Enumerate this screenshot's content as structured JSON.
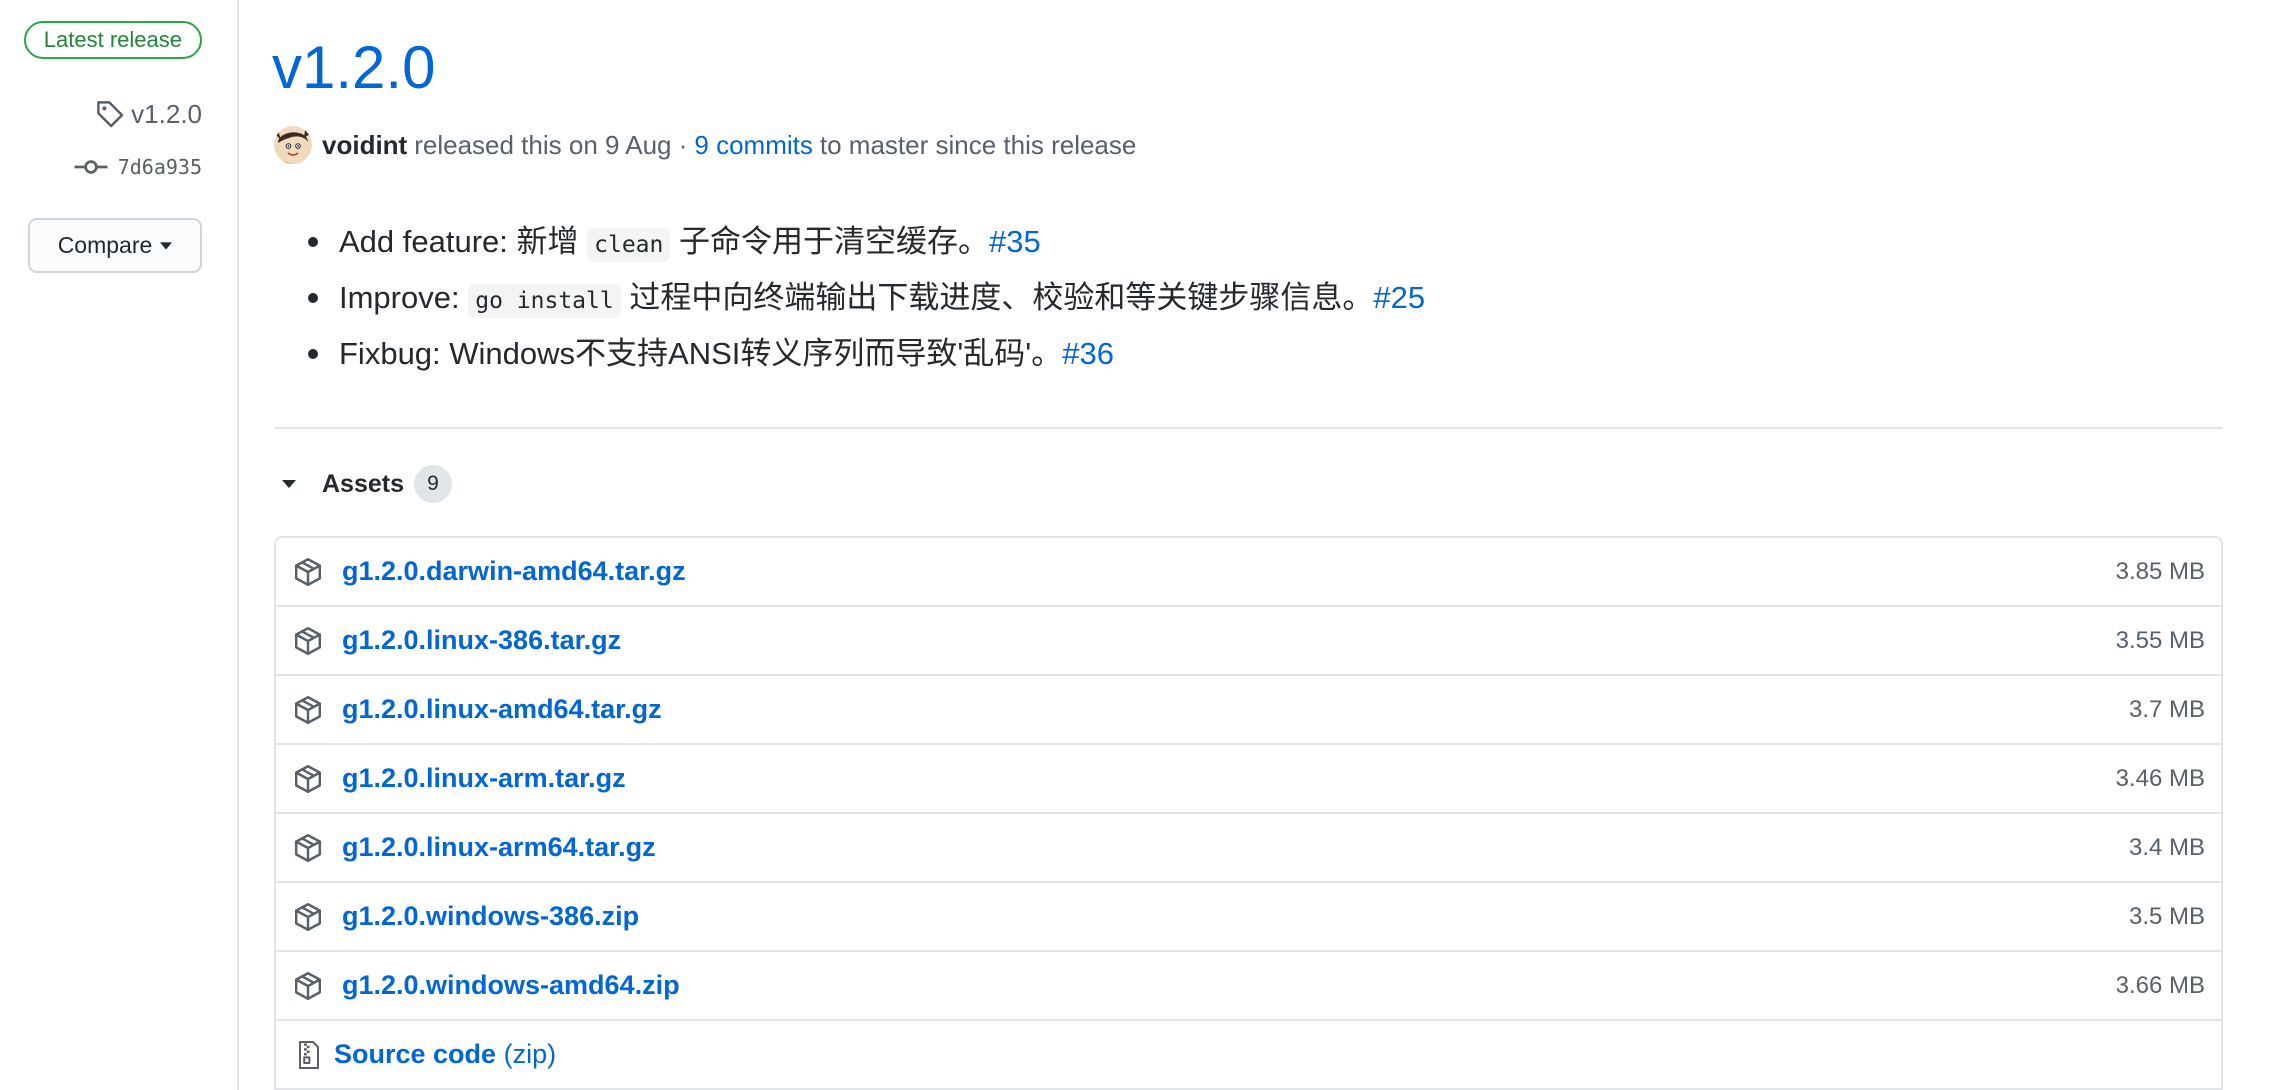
{
  "sidebar": {
    "badge": "Latest release",
    "tag": "v1.2.0",
    "commit": "7d6a935",
    "compare_label": "Compare"
  },
  "release": {
    "title": "v1.2.0",
    "author": "voidint",
    "released_text": "released this on 9 Aug ·",
    "commits_link": "9 commits",
    "since_text": "to master since this release"
  },
  "notes": [
    {
      "prefix": "Add feature: 新增",
      "code": "clean",
      "suffix": "子命令用于清空缓存。",
      "issue": "#35"
    },
    {
      "prefix": "Improve:",
      "code": "go install",
      "suffix": "过程中向终端输出下载进度、校验和等关键步骤信息。",
      "issue": "#25"
    },
    {
      "text": "Fixbug: Windows不支持ANSI转义序列而导致'乱码'。",
      "issue": "#36"
    }
  ],
  "assets": {
    "label": "Assets",
    "count": "9",
    "files": [
      {
        "name": "g1.2.0.darwin-amd64.tar.gz",
        "size": "3.85 MB"
      },
      {
        "name": "g1.2.0.linux-386.tar.gz",
        "size": "3.55 MB"
      },
      {
        "name": "g1.2.0.linux-amd64.tar.gz",
        "size": "3.7 MB"
      },
      {
        "name": "g1.2.0.linux-arm.tar.gz",
        "size": "3.46 MB"
      },
      {
        "name": "g1.2.0.linux-arm64.tar.gz",
        "size": "3.4 MB"
      },
      {
        "name": "g1.2.0.windows-386.zip",
        "size": "3.5 MB"
      },
      {
        "name": "g1.2.0.windows-amd64.zip",
        "size": "3.66 MB"
      }
    ],
    "source_code": {
      "label": "Source code",
      "format": "(zip)"
    }
  },
  "icons": {
    "tag": "tag-icon",
    "commit": "git-commit-icon",
    "compare_caret": "triangle-down-icon",
    "assets_toggle": "triangle-down-icon",
    "asset": "package-icon",
    "source": "file-zip-icon"
  },
  "colors": {
    "link": "#0366d6",
    "text": "#24292e",
    "muted": "#586069",
    "border": "#e1e4e8",
    "badge_green": "#28a745",
    "badge_green_text": "#22863a"
  }
}
